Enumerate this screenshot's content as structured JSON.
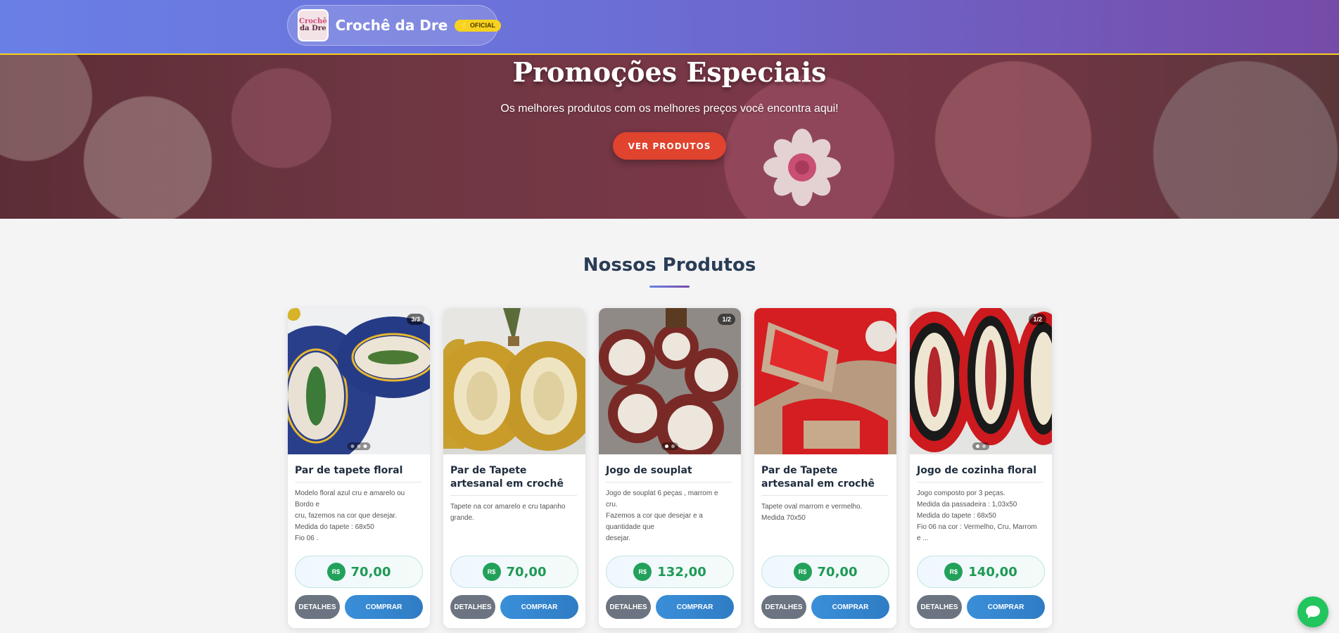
{
  "header": {
    "logo_text_1": "Crochê",
    "logo_text_2": "da Dre",
    "brand_name": "Crochê da Dre",
    "badge": "⭐ OFICIAL"
  },
  "hero": {
    "title": "Promoções Especiais",
    "subtitle": "Os melhores produtos com os melhores preços você encontra aqui!",
    "cta": "VER PRODUTOS"
  },
  "products_section": {
    "title": "Nossos Produtos"
  },
  "products": [
    {
      "title": "Par de tapete floral",
      "counter": "3/3",
      "description": "Modelo floral azul cru e amarelo ou\nBordo e\ncru, fazemos na cor que desejar.\nMedida do tapete : 68x50\nFio 06 .",
      "currency": "R$",
      "price": "70,00",
      "details_label": "DETALHES",
      "buy_label": "COMPRAR"
    },
    {
      "title": "Par de Tapete artesanal em crochê",
      "counter": "",
      "description": "Tapete na cor amarelo e cru tapanho\ngrande.",
      "currency": "R$",
      "price": "70,00",
      "details_label": "DETALHES",
      "buy_label": "COMPRAR"
    },
    {
      "title": "Jogo de souplat",
      "counter": "1/2",
      "description": "Jogo de souplat 6 peças , marrom e\ncru.\nFazemos a cor que desejar e a\nquantidade que\ndesejar.",
      "currency": "R$",
      "price": "132,00",
      "details_label": "DETALHES",
      "buy_label": "COMPRAR"
    },
    {
      "title": "Par de Tapete artesanal em crochê",
      "counter": "",
      "description": "Tapete oval marrom e vermelho.\nMedida 70x50",
      "currency": "R$",
      "price": "70,00",
      "details_label": "DETALHES",
      "buy_label": "COMPRAR"
    },
    {
      "title": "Jogo de cozinha floral",
      "counter": "1/2",
      "description": "Jogo composto por 3 peças.\nMedida da passadeira : 1,03x50\nMedida do tapete : 68x50\nFio 06 na cor : Vermelho, Cru, Marrom\ne ...",
      "currency": "R$",
      "price": "140,00",
      "details_label": "DETALHES",
      "buy_label": "COMPRAR"
    }
  ],
  "colors": {
    "header_start": "#6a7fe6",
    "header_end": "#764ba8",
    "hero_button": "#e0432e",
    "price_green": "#1e9a54",
    "buy_blue": "#3a8fd9",
    "details_gray": "#6b7480",
    "chat_green": "#22c55e"
  },
  "icons": {
    "chat": "chat-bubble-icon"
  }
}
